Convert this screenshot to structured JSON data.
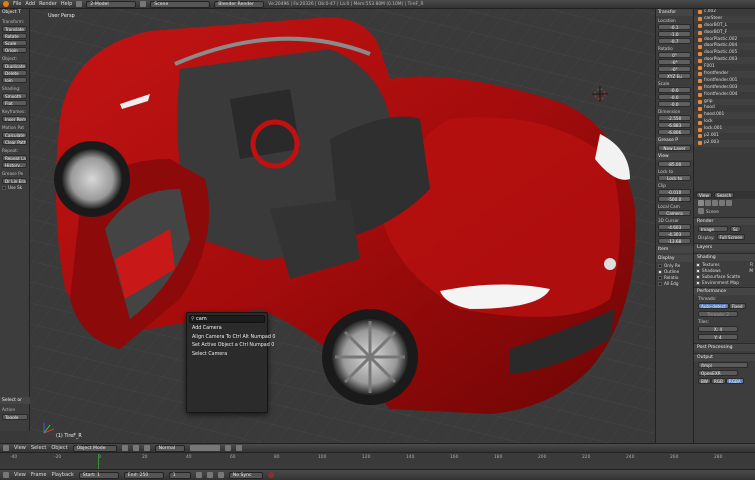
{
  "topbar": {
    "menus": [
      "File",
      "Add",
      "Render",
      "Help"
    ],
    "screen_layout": "2-Model",
    "scene": "Scene",
    "render_engine": "Blender Render",
    "stats": "Ve:20496 | Fa:20326 | Ob:0-47 | La:0 | Mem:553.80M (0.10M) | TireF_R"
  },
  "tool_shelf": {
    "title": "Object T",
    "transform_label": "Transform:",
    "transform_buttons": [
      "Translate",
      "Rotate",
      "Scale",
      "Origin"
    ],
    "object_label": "Object:",
    "object_buttons": [
      "Duplicate",
      "Delete",
      "Join"
    ],
    "shading_label": "Shading:",
    "shading_buttons": [
      "Smooth",
      "Flat"
    ],
    "keyframes_label": "Keyframes:",
    "keyframe_buttons": [
      "Inser Rem"
    ],
    "motion_label": "Motion Pat",
    "motion_buttons": [
      "Calculate",
      "Clear Path"
    ],
    "repeat_label": "Repeat:",
    "repeat_buttons": [
      "Repeat La",
      "History..."
    ],
    "grease_label": "Grease Pe",
    "grease_items": [
      "Dr Lin Era",
      "Use Sk"
    ],
    "select_header": "Select or",
    "action_label": "Action",
    "action_value": "Toggle"
  },
  "viewport": {
    "label": "User Persp",
    "object_label": "(1) TireF_R"
  },
  "search_menu": {
    "query": "cam",
    "results": [
      "Add Camera",
      "Align Camera To  Ctrl Alt Numpad 0",
      "Set Active Object a  Ctrl Numpad 0",
      "Select Camera"
    ]
  },
  "n_panel": {
    "transform_header": "Transfor",
    "location_label": "Location",
    "location": [
      "-0.1",
      "-1.0",
      "-0.7"
    ],
    "rotation_label": "Rotatio",
    "rotation": [
      "0°",
      "-0°",
      "-0°"
    ],
    "rotation_mode": "XYZ Eu",
    "scale_label": "Scale",
    "scale": [
      "-0.0",
      "-0.0",
      "-0.0"
    ],
    "dimensions_label": "Dimension",
    "dimensions": [
      "-2.550",
      "-6.883",
      "-6.806"
    ],
    "cursor_header": "Grease P",
    "new_layer": "New Layer",
    "view_header": "View",
    "lens": "-85.00",
    "lock_label": "Lock to",
    "lock_to": "Lock to",
    "clip_label": "Clip",
    "clip_start": "-0.010",
    "clip_end": "-500.0",
    "local_cam_label": "Local Cam",
    "camera": "Camera",
    "cursor3d_label": "3D Cursor",
    "cursor3d": [
      "-4.603",
      "-4.303",
      "-13.68"
    ],
    "item_header": "Item",
    "display_header": "Display",
    "display_items": [
      "Only Re",
      "Outline",
      "Relatio",
      "All Edg"
    ]
  },
  "outliner": {
    "items": [
      "c.002",
      "carSteer",
      "doorBOT_L",
      "doorBOT_F",
      "doorPlastic.002",
      "doorPlastic.004",
      "doorPlastic.005",
      "doorPlastic.003",
      "F001",
      "frontfender",
      "frontfender.001",
      "frontfender.003",
      "frontfender.004",
      "grip",
      "hood",
      "hood.001",
      "lock",
      "lock.001",
      "p2.001",
      "p2.003"
    ]
  },
  "properties": {
    "tabs": [
      "View",
      "Search"
    ],
    "scene_label": "Scene",
    "render_header": "Render",
    "render_buttons": [
      "Image",
      "Sc"
    ],
    "display_label": "Display:",
    "display_value": "Full Screen",
    "layers_header": "Layers",
    "shading_header": "Shading",
    "shading_opts": [
      "Textures",
      "Shadows",
      "Subsurface Scatte",
      "Environment Map"
    ],
    "shading_opts_right": [
      "R",
      "M"
    ],
    "performance_header": "Performance",
    "threads_label": "Threads:",
    "threads_modes": [
      "Auto-detect",
      "Fixed"
    ],
    "threads_value": "Threads: 2",
    "tiles_label": "Tiles:",
    "tiles_x": "X: 4",
    "tiles_y": "Y: 4",
    "post_header": "Post Processing",
    "output_header": "Output",
    "output_path": "/tmp\\",
    "format": "OpenEXR",
    "color_modes": [
      "BW",
      "RGB",
      "RGBA"
    ]
  },
  "viewport_header": {
    "menus": [
      "View",
      "Select",
      "Object"
    ],
    "mode": "Object Mode",
    "shading": "Normal"
  },
  "timeline": {
    "ticks": [
      "-40",
      "-20",
      "0",
      "20",
      "40",
      "60",
      "80",
      "100",
      "120",
      "140",
      "160",
      "180",
      "200",
      "220",
      "240",
      "260",
      "280"
    ]
  },
  "timeline_header": {
    "menus": [
      "View",
      "Frame",
      "Playback"
    ],
    "start": "Start: 1",
    "end": "End: 250",
    "current": "1",
    "sync": "No Sync"
  }
}
